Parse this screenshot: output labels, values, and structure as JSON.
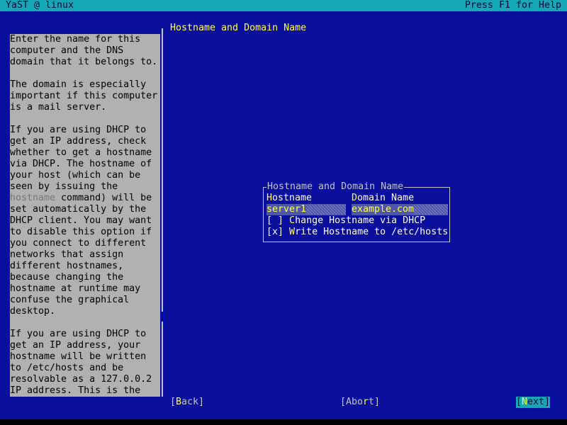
{
  "window": {
    "title": "YaST @ linux",
    "help_hint": "Press F1 for Help"
  },
  "page": {
    "title": "Hostname and Domain Name"
  },
  "help": {
    "lines": [
      "Enter the name for this",
      "computer and the DNS",
      "domain that it belongs to.",
      "",
      "The domain is especially",
      "important if this computer",
      "is a mail server.",
      "",
      "If you are using DHCP to",
      "get an IP address, check",
      "whether to get a hostname",
      "via DHCP. The hostname of",
      "your host (which can be",
      "seen by issuing the",
      "",
      "set automatically by the",
      "DHCP client. You may want",
      "to disable this option if",
      "you connect to different",
      "networks that assign",
      "different hostnames,",
      "because changing the",
      "hostname at runtime may",
      "confuse the graphical",
      "desktop.",
      "",
      "If you are using DHCP to",
      "get an IP address, your",
      "hostname will be written",
      "to /etc/hosts and be",
      "resolvable as a 127.0.0.2",
      "IP address. This is the"
    ],
    "cmd_line_code": "hostname",
    "cmd_line_rest": " command) will be"
  },
  "dialog": {
    "frame_title": "Hostname and Domain Name",
    "hostname_label_hot": "H",
    "hostname_label_rest": "ostname",
    "domain_label_hot": "D",
    "domain_label_rest": "omain Name",
    "hostname_value": "server1",
    "domain_value": "example.com",
    "dhcp_check_box": "[ ]",
    "dhcp_label_pre": " ",
    "dhcp_label_hot": "C",
    "dhcp_label_rest": "hange Hostname via DHCP",
    "dhcp_checked": false,
    "hosts_check_box": "[x]",
    "hosts_label_pre": " ",
    "hosts_label_hot": "W",
    "hosts_label_rest": "rite Hostname to /etc/hosts",
    "hosts_checked": true
  },
  "buttons": {
    "back": {
      "pre": "[",
      "hot": "B",
      "rest": "ack]"
    },
    "abort": {
      "pre": "[Abo",
      "hot": "r",
      "rest": "t]"
    },
    "next": {
      "pre": "[",
      "hot": "N",
      "rest": "ext]"
    }
  },
  "colors": {
    "background": "#0a0f9e",
    "accent": "#15a7b3",
    "hotkey": "#ffff54",
    "help_bg": "#b1b1b1"
  }
}
